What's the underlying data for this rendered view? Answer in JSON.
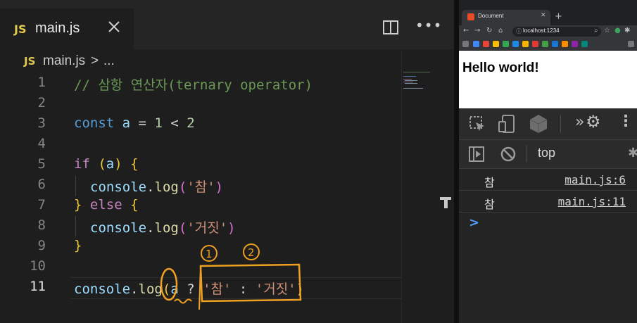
{
  "editor": {
    "tab": {
      "badge": "JS",
      "title": "main.js"
    },
    "breadcrumb": {
      "badge": "JS",
      "file": "main.js",
      "separator": ">",
      "symbol": "..."
    },
    "lines": [
      {
        "n": "1",
        "parts": [
          [
            "c-comment",
            "// 삼항 연산자(ternary operator)"
          ]
        ]
      },
      {
        "n": "2",
        "parts": []
      },
      {
        "n": "3",
        "parts": [
          [
            "c-kw",
            "const"
          ],
          [
            "",
            " "
          ],
          [
            "c-var",
            "a"
          ],
          [
            "",
            " = "
          ],
          [
            "c-num",
            "1"
          ],
          [
            "",
            " < "
          ],
          [
            "c-num",
            "2"
          ]
        ]
      },
      {
        "n": "4",
        "parts": []
      },
      {
        "n": "5",
        "parts": [
          [
            "c-ctrl",
            "if"
          ],
          [
            "",
            " "
          ],
          [
            "c-br",
            "("
          ],
          [
            "c-var",
            "a"
          ],
          [
            "c-br",
            ")"
          ],
          [
            "",
            " "
          ],
          [
            "c-br",
            "{"
          ]
        ]
      },
      {
        "n": "6",
        "indent": true,
        "parts": [
          [
            "c-obj",
            "console"
          ],
          [
            "",
            "."
          ],
          [
            "c-fn",
            "log"
          ],
          [
            "c-br2",
            "("
          ],
          [
            "c-str",
            "'참'"
          ],
          [
            "c-br2",
            ")"
          ]
        ]
      },
      {
        "n": "7",
        "parts": [
          [
            "c-br",
            "}"
          ],
          [
            "",
            " "
          ],
          [
            "c-ctrl",
            "else"
          ],
          [
            "",
            " "
          ],
          [
            "c-br",
            "{"
          ]
        ]
      },
      {
        "n": "8",
        "indent": true,
        "parts": [
          [
            "c-obj",
            "console"
          ],
          [
            "",
            "."
          ],
          [
            "c-fn",
            "log"
          ],
          [
            "c-br2",
            "("
          ],
          [
            "c-str",
            "'거짓'"
          ],
          [
            "c-br2",
            ")"
          ]
        ]
      },
      {
        "n": "9",
        "parts": [
          [
            "c-br",
            "}"
          ]
        ]
      },
      {
        "n": "10",
        "parts": []
      },
      {
        "n": "11",
        "active": true,
        "parts": [
          [
            "c-obj",
            "console"
          ],
          [
            "",
            "."
          ],
          [
            "c-fn",
            "log"
          ],
          [
            "c-br",
            "("
          ],
          [
            "c-var",
            "a"
          ],
          [
            "",
            " ? "
          ],
          [
            "c-str",
            "'참'"
          ],
          [
            "",
            " : "
          ],
          [
            "c-str",
            "'거짓'"
          ],
          [
            "c-br",
            ")"
          ]
        ]
      }
    ],
    "annotations": {
      "mark_1": "1",
      "mark_2": "2"
    }
  },
  "browser": {
    "tab_title": "Document",
    "url": "localhost:1234",
    "page_heading": "Hello world!",
    "devtools": {
      "context": "top"
    },
    "console": [
      {
        "text": "참",
        "source": "main.js:6"
      },
      {
        "text": "참",
        "source": "main.js:11"
      }
    ],
    "prompt": ">"
  },
  "colors": {
    "editor_bg": "#1e1e1e",
    "annotation": "#f0a020",
    "keyword": "#569cd6",
    "string": "#ce9178",
    "comment": "#6a9955"
  }
}
